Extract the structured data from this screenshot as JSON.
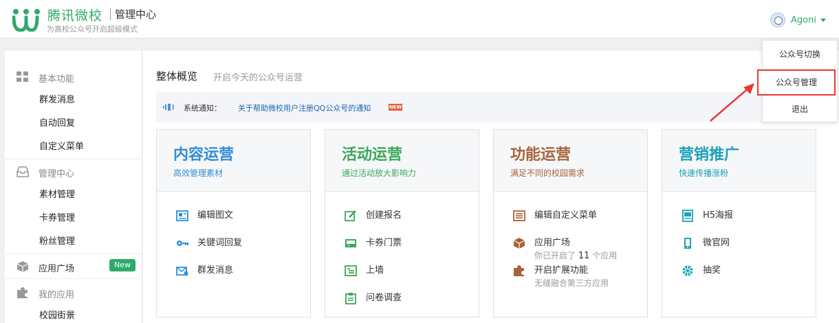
{
  "header": {
    "brand": "腾讯微校",
    "subtitle": "管理中心",
    "tagline": "为高校公众号开启超级模式",
    "user": "Agoni"
  },
  "dropdown": {
    "items": [
      "公众号切换",
      "公众号管理",
      "退出"
    ],
    "highlight_color": "#e53935"
  },
  "sidebar": {
    "sections": [
      {
        "label": "基本功能",
        "icon": "grid-icon",
        "items": [
          "群发消息",
          "自动回复",
          "自定义菜单"
        ]
      },
      {
        "label": "管理中心",
        "icon": "inbox-icon",
        "items": [
          "素材管理",
          "卡券管理",
          "粉丝管理"
        ]
      },
      {
        "label": "应用广场",
        "icon": "cube-icon",
        "badge": "New",
        "items": []
      },
      {
        "label": "我的应用",
        "icon": "puzzle-icon",
        "items": [
          "校园街景"
        ]
      }
    ]
  },
  "main": {
    "title": "整体概览",
    "subtitle": "开启今天的公众号运营",
    "notice": {
      "label": "系统通知：",
      "link": "关于帮助微校用户注册QQ公众号的通知",
      "badge": "NEW"
    },
    "cards": [
      {
        "title": "内容运营",
        "subtitle": "高效管理素材",
        "color": "#2f8ed8",
        "items": [
          {
            "label": "编辑图文",
            "icon": "article-icon"
          },
          {
            "label": "关键词回复",
            "icon": "key-icon"
          },
          {
            "label": "群发消息",
            "icon": "mail-icon"
          }
        ]
      },
      {
        "title": "活动运营",
        "subtitle": "通过活动放大影响力",
        "color": "#3aa85a",
        "items": [
          {
            "label": "创建报名",
            "icon": "edit-icon"
          },
          {
            "label": "卡券门票",
            "icon": "ticket-icon"
          },
          {
            "label": "上墙",
            "icon": "wall-icon"
          },
          {
            "label": "问卷调查",
            "icon": "clipboard-icon"
          }
        ]
      },
      {
        "title": "功能运营",
        "subtitle": "满足不同的校园需求",
        "color": "#a8633b",
        "items": [
          {
            "label": "编辑自定义菜单",
            "icon": "menu-icon"
          },
          {
            "label": "应用广场",
            "icon": "box-icon",
            "note_prefix": "你已开启了",
            "note_count": "11",
            "note_suffix": "个应用"
          },
          {
            "label": "开启扩展功能",
            "icon": "puzzle-icon",
            "note": "无缝融合第三方应用"
          }
        ]
      },
      {
        "title": "营销推广",
        "subtitle": "快速传播涨粉",
        "color": "#1aa1b8",
        "items": [
          {
            "label": "H5海报",
            "icon": "poster-icon"
          },
          {
            "label": "微官网",
            "icon": "phone-icon"
          },
          {
            "label": "抽奖",
            "icon": "wheel-icon"
          }
        ]
      }
    ]
  }
}
